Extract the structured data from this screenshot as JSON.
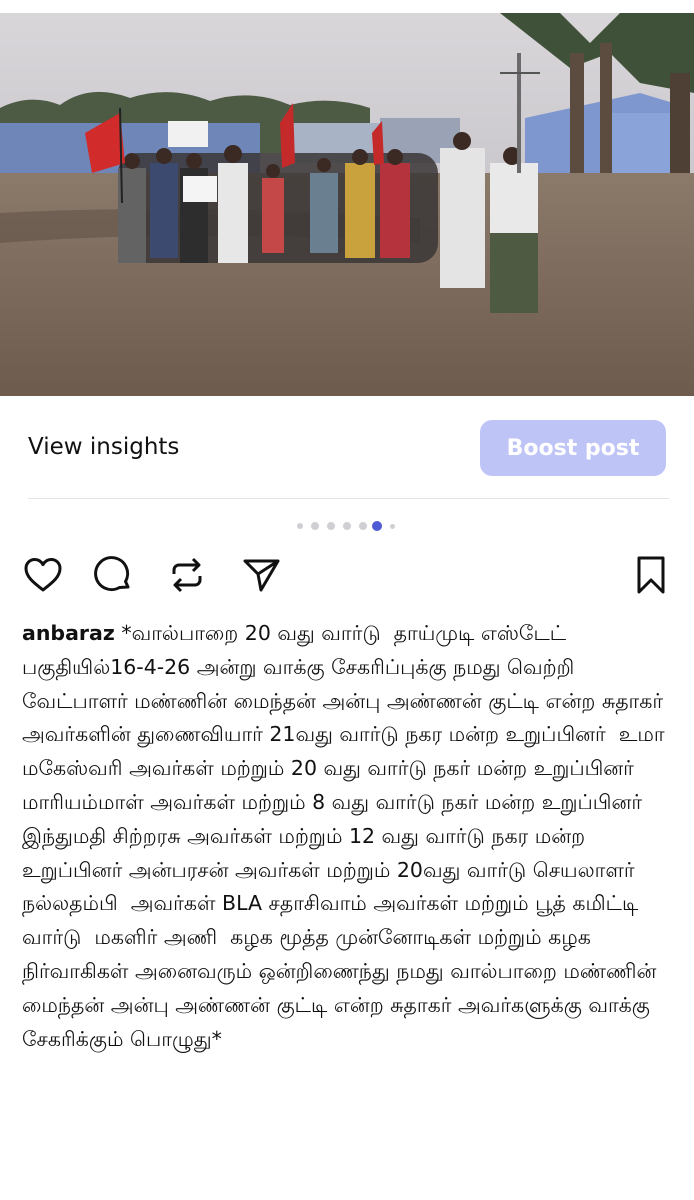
{
  "post": {
    "photo_description_icon": "group-photo",
    "insights_label": "View insights",
    "boost_label": "Boost post",
    "carousel": {
      "total": 7,
      "active": 6
    },
    "username": "anbaraz",
    "caption": "*வால்பாறை 20 வது வார்டு  தாய்முடி எஸ்டேட் பகுதியில்16-4-26 அன்று வாக்கு சேகரிப்புக்கு நமது வெற்றி வேட்பாளர் மண்ணின் மைந்தன் அன்பு அண்ணன் குட்டி என்ற சுதாகர் அவர்களின் துணைவியார் 21வது வார்டு நகர மன்ற உறுப்பினர்  உமா மகேஸ்வரி அவர்கள் மற்றும் 20 வது வார்டு நகர் மன்ற உறுப்பினர் மாரியம்மாள் அவர்கள் மற்றும் 8 வது வார்டு நகர் மன்ற உறுப்பினர் இந்துமதி சிற்றரசு அவர்கள் மற்றும் 12 வது வார்டு நகர மன்ற உறுப்பினர் அன்பரசன் அவர்கள் மற்றும் 20வது வார்டு செயலாளர் நல்லதம்பி  அவர்கள் BLA சதாசிவாம் அவர்கள் மற்றும் பூத் கமிட்டி வார்டு  மகளிர் அணி  கழக மூத்த முன்னோடிகள் மற்றும் கழக நிர்வாகிகள் அனைவரும் ஒன்றிணைந்து நமது வால்பாறை மண்ணின் மைந்தன் அன்பு அண்ணன் குட்டி என்ற சுதாகர் அவர்களுக்கு வாக்கு சேகரிக்கும் பொழுது*"
  },
  "icons": {
    "like": "heart-icon",
    "comment": "comment-icon",
    "repost": "repost-icon",
    "share": "send-icon",
    "save": "bookmark-icon"
  },
  "colors": {
    "boost_bg": "#bfc4f7",
    "dot_active": "#4f5bd5",
    "dot_inactive": "#cfcfd4"
  }
}
